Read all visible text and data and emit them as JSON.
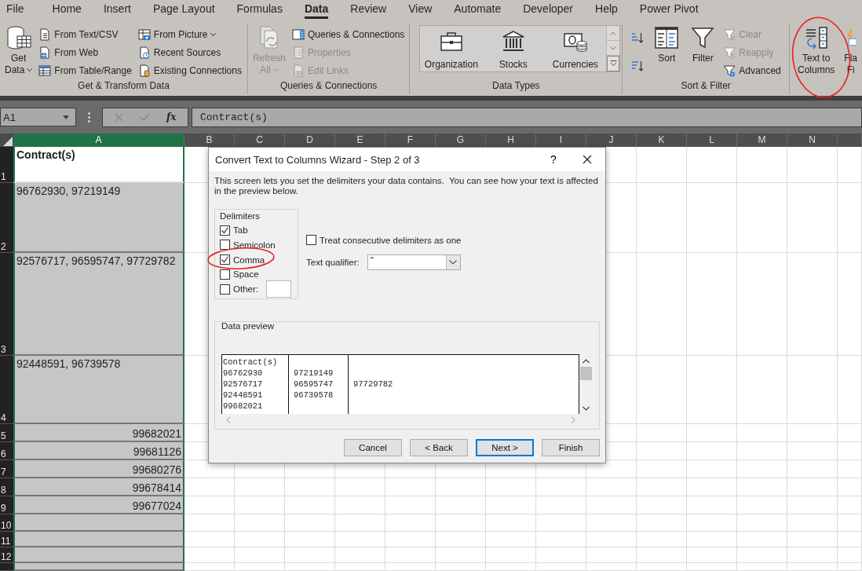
{
  "menu_tabs": [
    {
      "label": "File",
      "selected": false
    },
    {
      "label": "Home",
      "selected": false
    },
    {
      "label": "Insert",
      "selected": false
    },
    {
      "label": "Page Layout",
      "selected": false
    },
    {
      "label": "Formulas",
      "selected": false
    },
    {
      "label": "Data",
      "selected": true
    },
    {
      "label": "Review",
      "selected": false
    },
    {
      "label": "View",
      "selected": false
    },
    {
      "label": "Automate",
      "selected": false
    },
    {
      "label": "Developer",
      "selected": false
    },
    {
      "label": "Help",
      "selected": false
    },
    {
      "label": "Power Pivot",
      "selected": false
    }
  ],
  "ribbon": {
    "groups": [
      {
        "title": "Get & Transform Data",
        "items": [
          {
            "kind": "large",
            "lines": [
              "Get",
              "Data"
            ],
            "menu": true,
            "disabled": false
          },
          {
            "kind": "small",
            "label": "From Text/CSV",
            "menu": false,
            "disabled": false
          },
          {
            "kind": "small",
            "label": "From Web",
            "menu": false,
            "disabled": false
          },
          {
            "kind": "small",
            "label": "From Table/Range",
            "menu": false,
            "disabled": false
          },
          {
            "kind": "small",
            "label": "From Picture",
            "menu": true,
            "disabled": false
          },
          {
            "kind": "small",
            "label": "Recent Sources",
            "menu": false,
            "disabled": false
          },
          {
            "kind": "small",
            "label": "Existing Connections",
            "menu": false,
            "disabled": false
          }
        ]
      },
      {
        "title": "Queries & Connections",
        "items": [
          {
            "kind": "large",
            "lines": [
              "Refresh",
              "All"
            ],
            "menu": true,
            "disabled": true
          },
          {
            "kind": "small",
            "label": "Queries & Connections",
            "menu": false,
            "disabled": false
          },
          {
            "kind": "small",
            "label": "Properties",
            "menu": false,
            "disabled": true
          },
          {
            "kind": "small",
            "label": "Edit Links",
            "menu": false,
            "disabled": true
          }
        ]
      },
      {
        "title": "Data Types",
        "items": [
          {
            "kind": "gallery",
            "label": "Organization"
          },
          {
            "kind": "gallery",
            "label": "Stocks"
          },
          {
            "kind": "gallery",
            "label": "Currencies"
          }
        ]
      },
      {
        "title": "Sort & Filter",
        "items": [
          {
            "kind": "icon"
          },
          {
            "kind": "icon"
          },
          {
            "kind": "large",
            "lines": [
              "Sort"
            ],
            "menu": false,
            "disabled": false
          },
          {
            "kind": "large",
            "lines": [
              "Filter"
            ],
            "menu": false,
            "disabled": false
          },
          {
            "kind": "small",
            "label": "Clear",
            "menu": false,
            "disabled": true
          },
          {
            "kind": "small",
            "label": "Reapply",
            "menu": false,
            "disabled": true
          },
          {
            "kind": "small",
            "label": "Advanced",
            "menu": false,
            "disabled": false
          }
        ]
      },
      {
        "items": [
          {
            "kind": "large",
            "lines": [
              "Text to",
              "Columns"
            ],
            "menu": false,
            "disabled": false
          },
          {
            "kind": "large",
            "lines": [
              "Fla",
              "Fi"
            ],
            "menu": false,
            "disabled": false
          }
        ]
      }
    ]
  },
  "formula_bar": {
    "name_box": "A1",
    "function_label": "fx",
    "formula": "Contract(s)"
  },
  "sheet": {
    "columns": [
      {
        "label": "A",
        "selected": true
      },
      {
        "label": "B",
        "selected": false
      },
      {
        "label": "C",
        "selected": false
      },
      {
        "label": "D",
        "selected": false
      },
      {
        "label": "E",
        "selected": false
      },
      {
        "label": "F",
        "selected": false
      },
      {
        "label": "G",
        "selected": false
      },
      {
        "label": "H",
        "selected": false
      },
      {
        "label": "I",
        "selected": false
      },
      {
        "label": "J",
        "selected": false
      },
      {
        "label": "K",
        "selected": false
      },
      {
        "label": "L",
        "selected": false
      },
      {
        "label": "M",
        "selected": false
      },
      {
        "label": "N",
        "selected": false
      }
    ],
    "rows": [
      {
        "number": "1",
        "cells": [
          {
            "text": "Contract(s)",
            "kind": "header",
            "selected": true,
            "active": true
          }
        ]
      },
      {
        "number": "2",
        "cells": [
          {
            "text": "96762930, 97219149",
            "kind": "text",
            "selected": true,
            "active": false
          }
        ]
      },
      {
        "number": "3",
        "cells": [
          {
            "text": "92576717, 96595747, 97729782",
            "kind": "text",
            "selected": true,
            "active": false
          }
        ]
      },
      {
        "number": "4",
        "cells": [
          {
            "text": "92448591, 96739578",
            "kind": "text",
            "selected": true,
            "active": false
          }
        ]
      },
      {
        "number": "5",
        "cells": [
          {
            "text": "99682021",
            "kind": "number",
            "selected": true,
            "active": false
          }
        ]
      },
      {
        "number": "6",
        "cells": [
          {
            "text": "99681126",
            "kind": "number",
            "selected": true,
            "active": false
          }
        ]
      },
      {
        "number": "7",
        "cells": [
          {
            "text": "99680276",
            "kind": "number",
            "selected": true,
            "active": false
          }
        ]
      },
      {
        "number": "8",
        "cells": [
          {
            "text": "99678414",
            "kind": "number",
            "selected": true,
            "active": false
          }
        ]
      },
      {
        "number": "9",
        "cells": [
          {
            "text": "99677024",
            "kind": "number",
            "selected": true,
            "active": false
          }
        ]
      },
      {
        "number": "10",
        "cells": [
          {
            "selected": true,
            "active": false
          }
        ]
      },
      {
        "number": "11",
        "cells": [
          {
            "selected": true,
            "active": false
          }
        ]
      },
      {
        "number": "12",
        "cells": [
          {
            "selected": true,
            "active": false
          }
        ]
      },
      {
        "cells": [
          {
            "selected": true,
            "active": false
          }
        ]
      }
    ]
  },
  "dialog": {
    "title": "Convert Text to Columns Wizard - Step 2 of 3",
    "help_label": "?",
    "description": "This screen lets you set the delimiters your data contains.  You can see how your text is affected in the preview below.",
    "delimiters": {
      "title": "Delimiters",
      "options": [
        {
          "label": "Tab",
          "checked": true,
          "has_field": false
        },
        {
          "label": "Semicolon",
          "checked": false,
          "has_field": false
        },
        {
          "label": "Comma",
          "checked": true,
          "has_field": false
        },
        {
          "label": "Space",
          "checked": false,
          "has_field": false
        },
        {
          "label": "Other:",
          "checked": false,
          "has_field": true
        }
      ]
    },
    "consecutive": {
      "label": "Treat consecutive delimiters as one",
      "checked": false
    },
    "qualifier": {
      "label": "Text qualifier:",
      "value": "\""
    },
    "preview": {
      "title": "Data preview",
      "rows": [
        [
          "Contract(s)"
        ],
        [
          "96762930",
          "97219149"
        ],
        [
          "92576717",
          "96595747",
          "97729782"
        ],
        [
          "92448591",
          "96739578"
        ],
        [
          "99682021"
        ]
      ]
    },
    "buttons": [
      {
        "label": "Cancel",
        "focused": false
      },
      {
        "label": "< Back",
        "focused": false
      },
      {
        "label": "Next >",
        "focused": true
      },
      {
        "label": "Finish",
        "focused": false
      }
    ]
  }
}
